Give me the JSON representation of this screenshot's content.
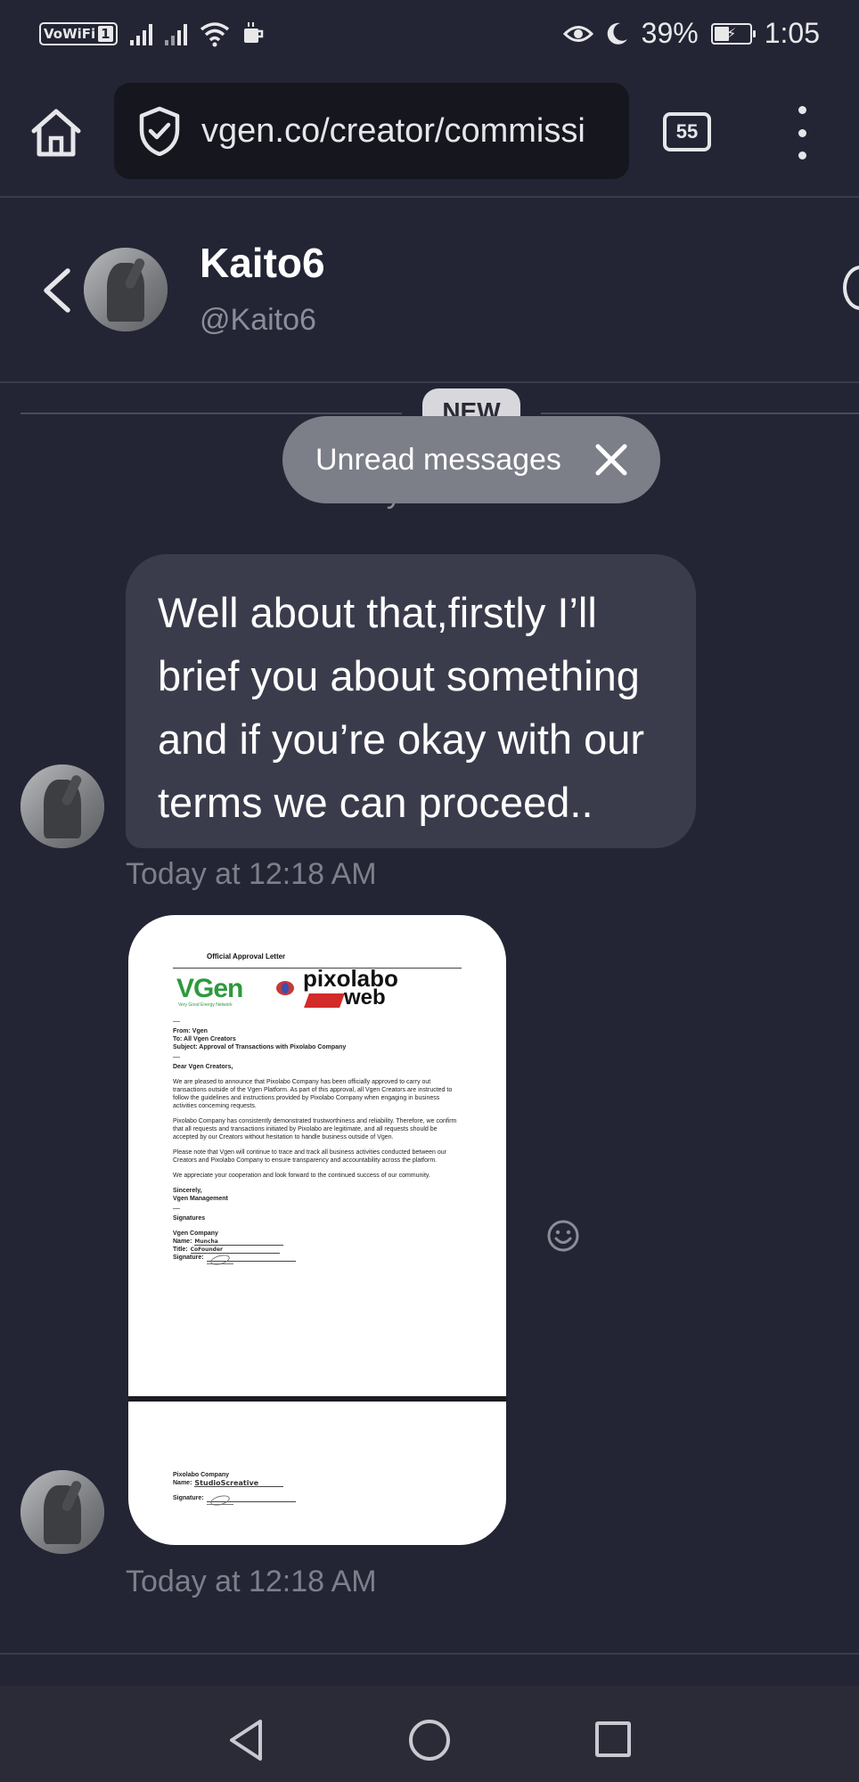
{
  "status_bar": {
    "vowifi": "VoWiFi",
    "sim_slot": "1",
    "battery_percent": "39%",
    "time": "1:05"
  },
  "browser": {
    "url": "vgen.co/creator/commissi",
    "tab_count": "55"
  },
  "chat": {
    "name": "Kaito6",
    "handle": "@Kaito6",
    "new_badge": "NEW",
    "date_peek": "Today at 12:18 AM",
    "toast": "Unread messages",
    "messages": [
      {
        "text": "Well about that,firstly I’ll brief you about something and if you’re okay with our terms we can proceed..",
        "time": "Today at 12:18 AM"
      },
      {
        "time": "Today at 12:18 AM",
        "attachment": {
          "title": "Official Approval Letter",
          "vgen_logo": "VGen",
          "vgen_tagline": "Very Good Energy Network",
          "partner_logo_line1": "pixolabo",
          "partner_logo_line2": "web",
          "from": "From: Vgen",
          "to": "To: All Vgen Creators",
          "subject": "Subject: Approval of Transactions with Pixolabo Company",
          "greeting": "Dear Vgen Creators,",
          "para1": "We are pleased to announce that Pixolabo Company has been officially approved to carry out transactions outside of the Vgen Platform. As part of this approval, all Vgen Creators are instructed to follow the guidelines and instructions provided by Pixolabo Company when engaging in business activities concerning requests.",
          "para2": "Pixolabo Company has consistently demonstrated trustworthiness and reliability. Therefore, we confirm that all requests and transactions initiated by Pixolabo are legitimate, and all requests should be accepted by our Creators without hesitation to handle business outside of Vgen.",
          "para3": "Please note that Vgen will continue to trace and track all business activities conducted between our Creators and Pixolabo Company to ensure transparency and accountability across the platform.",
          "para4": "We appreciate your cooperation and look forward to the continued success of our community.",
          "closing1": "Sincerely,",
          "closing2": "Vgen Management",
          "signatures_heading": "Signatures",
          "company1": "Vgen Company",
          "name_label": "Name:",
          "name1_value": "Muncha",
          "title_label": "Title:",
          "title1_value": "CoFounder",
          "signature_label": "Signature:",
          "company2": "Pixolabo Company",
          "name2_value": "StudioScreative"
        }
      }
    ]
  },
  "icons": {
    "home": "home-icon",
    "shield": "shield-check-icon",
    "more": "more-vert-icon",
    "back": "chevron-left-icon",
    "close": "close-icon",
    "react": "emoji-smile-icon",
    "nav_back": "triangle-back-icon",
    "nav_home": "circle-home-icon",
    "nav_recent": "square-recents-icon"
  },
  "colors": {
    "background": "#232534",
    "bubble": "#3b3c4b",
    "toast": "#7c7e88",
    "muted_text": "#8b8d99"
  }
}
